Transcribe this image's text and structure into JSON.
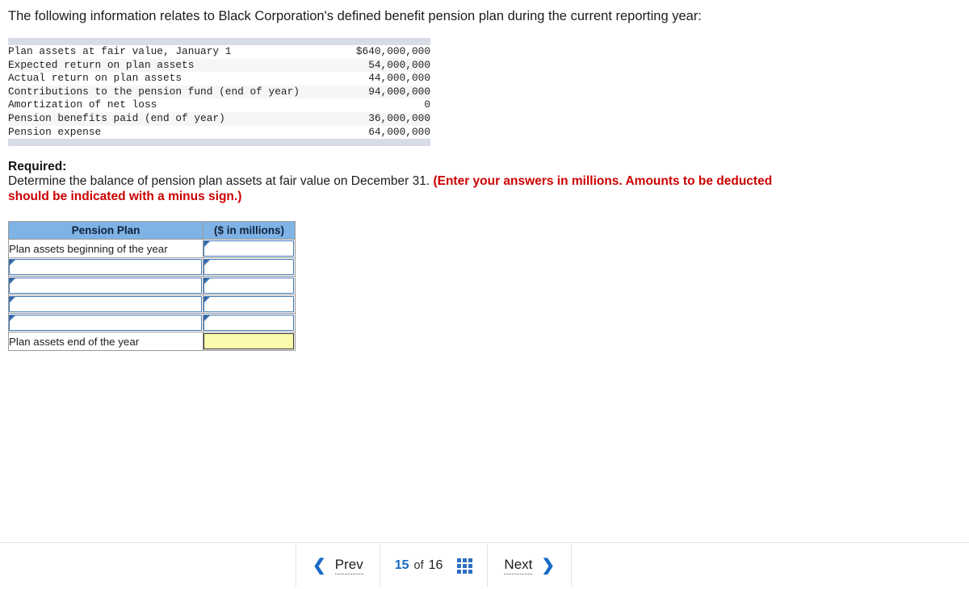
{
  "intro": {
    "text": "The following information relates to Black Corporation's defined benefit pension plan during the current reporting year:"
  },
  "facts_table": {
    "rows": [
      {
        "label": "Plan assets at fair value, January 1",
        "value": "$640,000,000"
      },
      {
        "label": "Expected return on plan assets",
        "value": "54,000,000"
      },
      {
        "label": "Actual return on plan assets",
        "value": "44,000,000"
      },
      {
        "label": "Contributions to the pension fund (end of year)",
        "value": "94,000,000"
      },
      {
        "label": "Amortization of net loss",
        "value": "0"
      },
      {
        "label": "Pension benefits paid (end of year)",
        "value": "36,000,000"
      },
      {
        "label": "Pension expense",
        "value": "64,000,000"
      }
    ]
  },
  "required": {
    "heading": "Required:",
    "statement": "Determine the balance of pension plan assets at fair value on December 31. ",
    "emphasis": "(Enter your answers in millions. Amounts to be deducted should be indicated with a minus sign.)"
  },
  "answer_table": {
    "headers": [
      "Pension Plan",
      "($ in millions)"
    ],
    "rows": [
      {
        "type": "label",
        "label": "Plan assets beginning of the year",
        "value": "",
        "value_type": "select"
      },
      {
        "type": "select",
        "label": "",
        "value": "",
        "value_type": "select"
      },
      {
        "type": "select",
        "label": "",
        "value": "",
        "value_type": "select"
      },
      {
        "type": "select",
        "label": "",
        "value": "",
        "value_type": "select"
      },
      {
        "type": "select",
        "label": "",
        "value": "",
        "value_type": "select"
      },
      {
        "type": "total",
        "label": "Plan assets end of the year",
        "value": "",
        "value_type": "computed"
      }
    ]
  },
  "navigation": {
    "prev_label": "Prev",
    "next_label": "Next",
    "current_page": "15",
    "of_label": "of",
    "total_pages": "16",
    "grid_icon": "grid-icon"
  },
  "colors": {
    "header_blue": "#7fb2e5",
    "select_border": "#4176b4",
    "result_yellow": "#fbfbae",
    "accent_link": "#1a6bc4",
    "alert_red": "#cc0000",
    "band_gray": "#d7dce7"
  }
}
